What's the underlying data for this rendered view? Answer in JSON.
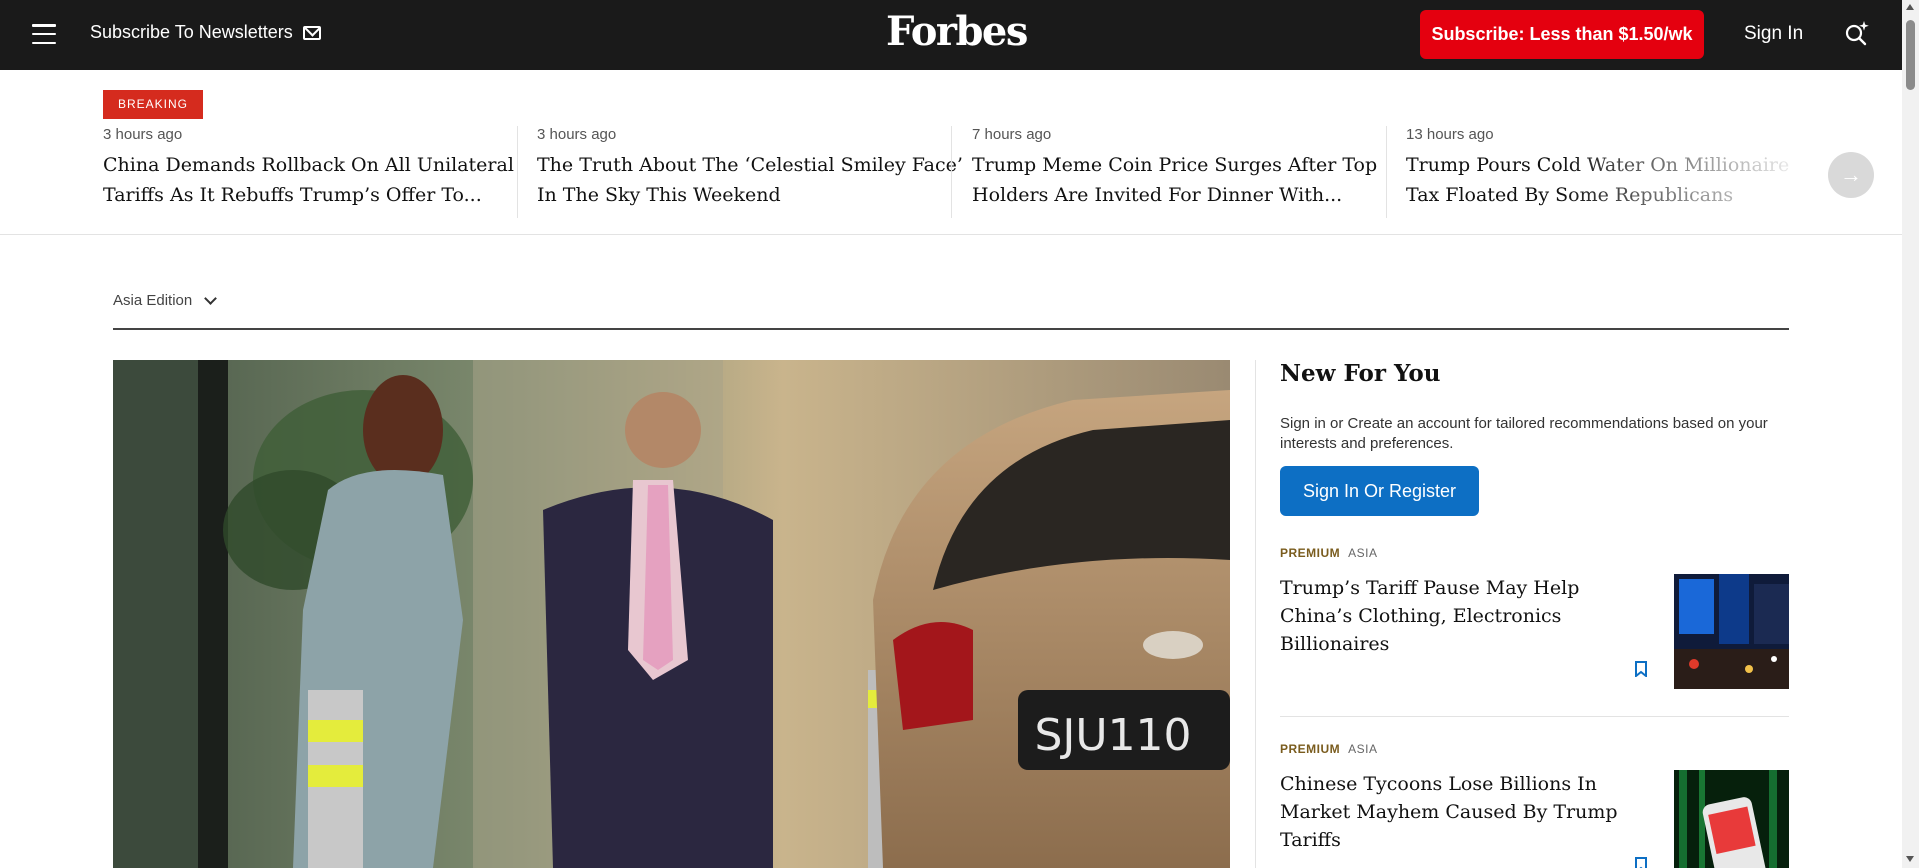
{
  "header": {
    "newsletter_label": "Subscribe To Newsletters",
    "logo": "Forbes",
    "subscribe_label": "Subscribe: Less than $1.50/wk",
    "signin_label": "Sign In",
    "icons": [
      "menu-icon",
      "mail-icon",
      "search-sparkle-icon"
    ]
  },
  "ticker": {
    "badge": "BREAKING",
    "items": [
      {
        "time": "3 hours ago",
        "headline": "China Demands Rollback On All Unilateral Tariffs As It Rebuffs Trump’s Offer To..."
      },
      {
        "time": "3 hours ago",
        "headline": "The Truth About The ‘Celestial Smiley Face’ In The Sky This Weekend"
      },
      {
        "time": "7 hours ago",
        "headline": "Trump Meme Coin Price Surges After Top Holders Are Invited For Dinner With..."
      },
      {
        "time": "13 hours ago",
        "headline": "Trump Pours Cold Water On Millionaire Tax Floated By Some Republicans"
      }
    ],
    "next_icon": "arrow-right-icon"
  },
  "edition": {
    "label": "Asia Edition"
  },
  "hero": {
    "plate_text": "SJU110"
  },
  "new_for_you": {
    "title": "New For You",
    "description": "Sign in or Create an account for tailored recommendations based on your interests and preferences.",
    "button_label": "Sign In Or Register",
    "stories": [
      {
        "tag": "PREMIUM",
        "region": "ASIA",
        "title": "Trump’s Tariff Pause May Help China’s Clothing, Electronics Billionaires"
      },
      {
        "tag": "PREMIUM",
        "region": "ASIA",
        "title": "Chinese Tycoons Lose Billions In Market Mayhem Caused By Trump Tariffs"
      }
    ]
  },
  "colors": {
    "topbar": "#1a1a1a",
    "subscribe": "#e4000f",
    "breaking": "#d52b1e",
    "register": "#0d6fc4",
    "premium": "#7a5c1e"
  }
}
